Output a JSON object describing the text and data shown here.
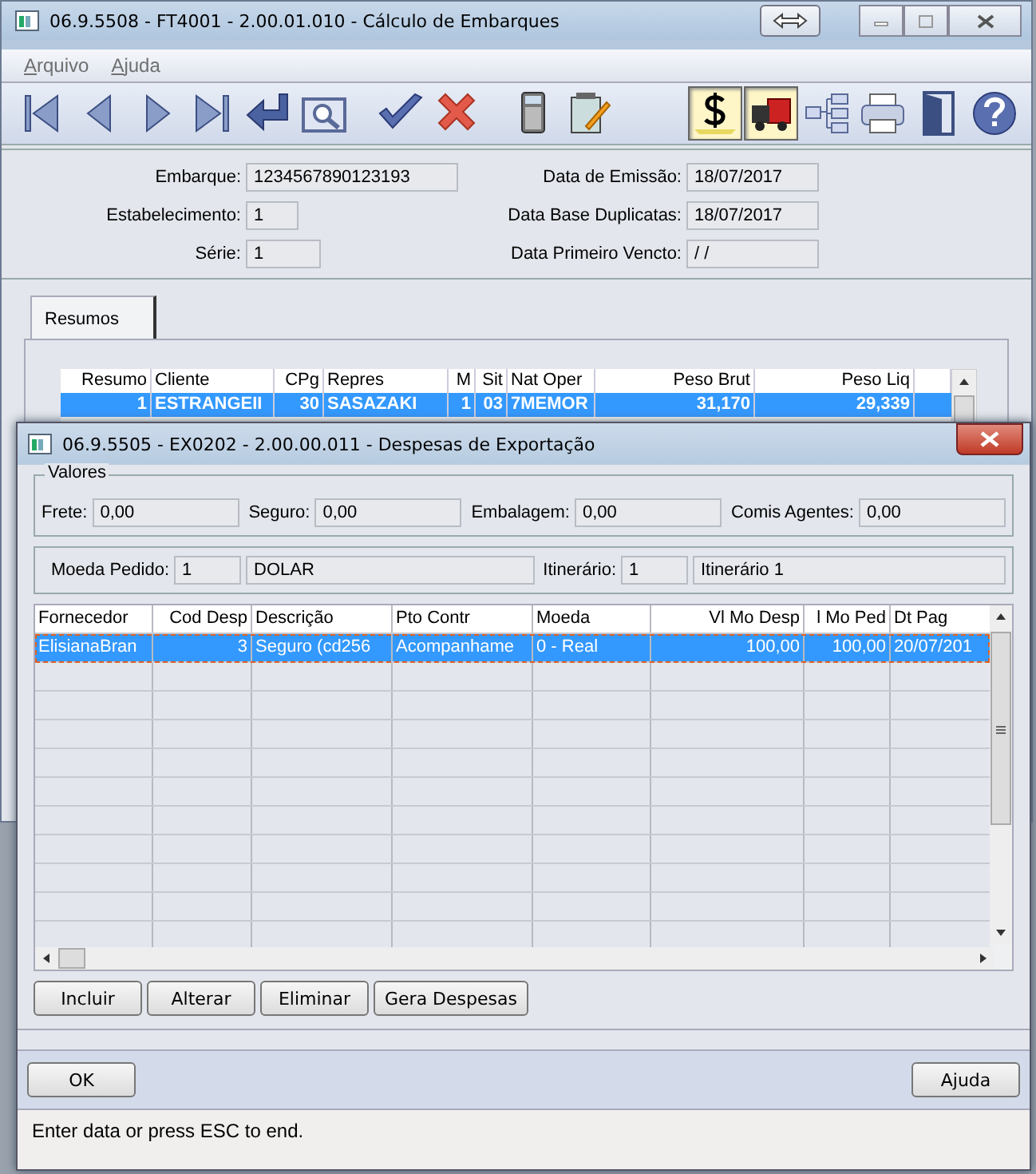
{
  "main_window": {
    "title": "06.9.5508 - FT4001 - 2.00.01.010 - Cálculo de Embarques",
    "menu": [
      "Arquivo",
      "Ajuda"
    ],
    "toolbar": [
      {
        "pressed": false
      },
      {
        "pressed": false
      },
      {
        "pressed": false
      },
      {
        "pressed": false
      },
      {
        "pressed": false
      },
      {
        "pressed": false
      },
      {
        "pressed": false
      },
      {
        "pressed": false
      },
      {
        "pressed": false
      },
      {
        "pressed": false
      },
      {
        "pressed": true
      },
      {
        "pressed": true
      },
      {
        "pressed": false
      },
      {
        "pressed": false
      },
      {
        "pressed": false
      },
      {
        "pressed": false
      }
    ],
    "fields_left": [
      {
        "label": "Embarque:",
        "value": "1234567890123193"
      },
      {
        "label": "Estabelecimento:",
        "value": "1"
      },
      {
        "label": "Série:",
        "value": "1"
      }
    ],
    "fields_right": [
      {
        "label": "Data de Emissão:",
        "value": "18/07/2017"
      },
      {
        "label": "Data Base Duplicatas:",
        "value": "18/07/2017"
      },
      {
        "label": "Data Primeiro Vencto:",
        "value": " / /"
      }
    ],
    "tabs": [
      {
        "label": "Resumos",
        "selected": true
      }
    ],
    "table": {
      "columns": [
        "Resumo",
        "Cliente",
        "CPg",
        "Repres",
        "M",
        "Sit",
        "Nat Oper",
        "Peso Brut",
        "Peso Liq"
      ],
      "rows": [
        {
          "selected": true,
          "cells": [
            "1",
            "ESTRANGEII",
            "30",
            "SASAZAKI",
            "1",
            "03",
            "7MEMOR",
            "31,170",
            "29,339"
          ]
        }
      ]
    }
  },
  "dialog": {
    "title": "06.9.5505 - EX0202 - 2.00.00.011 - Despesas de Exportação",
    "valores": {
      "title": "Valores",
      "fields": [
        {
          "label": "Frete:",
          "value": "0,00"
        },
        {
          "label": "Seguro:",
          "value": "0,00"
        },
        {
          "label": "Embalagem:",
          "value": "0,00"
        },
        {
          "label": "Comis Agentes:",
          "value": "0,00"
        }
      ]
    },
    "moeda": [
      {
        "label": "Moeda Pedido:",
        "value": "1",
        "description": "DOLAR"
      },
      {
        "label": "Itinerário:",
        "value": "1",
        "description": "Itinerário 1"
      }
    ],
    "table": {
      "columns": [
        "Fornecedor",
        "Cod Desp",
        "Descrição",
        "Pto Contr",
        "Moeda",
        "Vl Mo Desp",
        "l Mo Ped",
        "Dt Pag"
      ],
      "rows": [
        {
          "selected": true,
          "cells": [
            "ElisianaBran",
            "3",
            "Seguro (cd256",
            "Acompanhame",
            "0 - Real",
            "100,00",
            "100,00",
            "20/07/201"
          ]
        }
      ]
    },
    "actions": [
      "Incluir",
      "Alterar",
      "Eliminar",
      "Gera Despesas"
    ],
    "ok": "OK",
    "help": "Ajuda",
    "status_bar": "Enter data or press ESC to end."
  }
}
